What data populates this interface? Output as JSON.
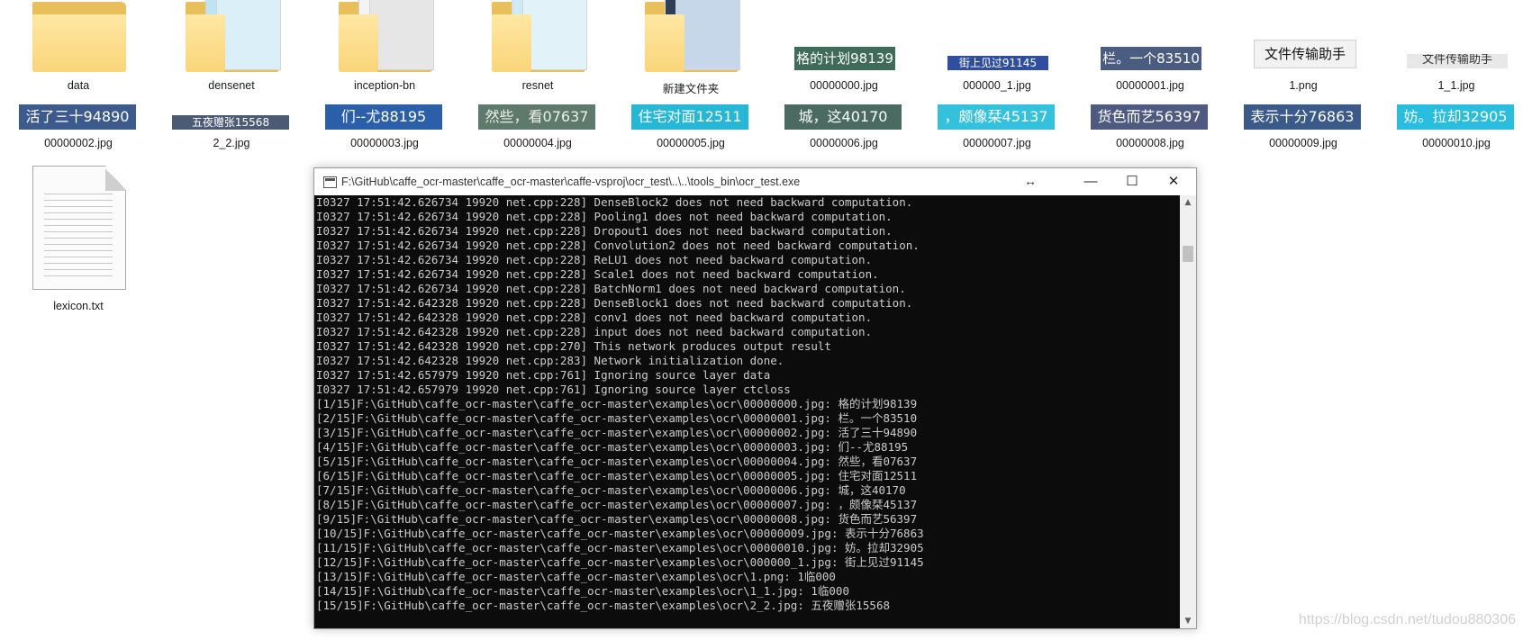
{
  "explorer": {
    "row1": [
      {
        "kind": "folder",
        "name": "data"
      },
      {
        "kind": "folder",
        "name": "densenet"
      },
      {
        "kind": "folder",
        "name": "inception-bn"
      },
      {
        "kind": "folder",
        "name": "resnet"
      },
      {
        "kind": "folder",
        "name": "新建文件夹"
      },
      {
        "kind": "image",
        "name": "00000000.jpg",
        "text": "格的计划98139",
        "bg": "#3f6b5a",
        "fg": "#ffffff"
      },
      {
        "kind": "image",
        "name": "000000_1.jpg",
        "text": "街上见过91145",
        "bg": "#2f4f9e",
        "fg": "#ffffff"
      },
      {
        "kind": "image",
        "name": "00000001.jpg",
        "text": "栏。一个83510",
        "bg": "#4a5d80",
        "fg": "#ffffff"
      },
      {
        "kind": "image",
        "name": "1.png",
        "text": "文件传输助手",
        "bg": "#f2f2f2",
        "fg": "#111111"
      },
      {
        "kind": "image",
        "name": "1_1.jpg",
        "text": "文件传输助手",
        "bg": "#e8e8e8",
        "fg": "#333333"
      }
    ],
    "row2": [
      {
        "name": "00000002.jpg",
        "text": "活了三十94890",
        "bg": "#3c5a8c",
        "fg": "#ffffff"
      },
      {
        "name": "2_2.jpg",
        "text": "五夜赠张15568",
        "bg": "#4c5a74",
        "fg": "#ffffff"
      },
      {
        "name": "00000003.jpg",
        "text": "们--尤88195",
        "bg": "#2c5faa",
        "fg": "#ffffff"
      },
      {
        "name": "00000004.jpg",
        "text": "然些，看07637",
        "bg": "#5e7a6c",
        "fg": "#eeeeee"
      },
      {
        "name": "00000005.jpg",
        "text": "住宅对面12511",
        "bg": "#27b7d6",
        "fg": "#ffffff"
      },
      {
        "name": "00000006.jpg",
        "text": "城，这40170",
        "bg": "#4b6b62",
        "fg": "#ffffff"
      },
      {
        "name": "00000007.jpg",
        "text": "，颇像栞45137",
        "bg": "#33c1de",
        "fg": "#ffffff"
      },
      {
        "name": "00000008.jpg",
        "text": "货色而艺56397",
        "bg": "#4e5a80",
        "fg": "#ffffff"
      },
      {
        "name": "00000009.jpg",
        "text": "表示十分76863",
        "bg": "#3b5a8a",
        "fg": "#ffffff"
      },
      {
        "name": "00000010.jpg",
        "text": "妨。拉却32905",
        "bg": "#29bde0",
        "fg": "#ffffff"
      }
    ],
    "row3": [
      {
        "kind": "text-file",
        "name": "lexicon.txt"
      }
    ]
  },
  "console_window": {
    "title": "F:\\GitHub\\caffe_ocr-master\\caffe_ocr-master\\caffe-vsproj\\ocr_test\\..\\..\\tools_bin\\ocr_test.exe",
    "controls": {
      "minimize": "—",
      "maximize": "☐",
      "close": "✕"
    },
    "lines": [
      "I0327 17:51:42.626734 19920 net.cpp:228] DenseBlock2 does not need backward computation.",
      "I0327 17:51:42.626734 19920 net.cpp:228] Pooling1 does not need backward computation.",
      "I0327 17:51:42.626734 19920 net.cpp:228] Dropout1 does not need backward computation.",
      "I0327 17:51:42.626734 19920 net.cpp:228] Convolution2 does not need backward computation.",
      "I0327 17:51:42.626734 19920 net.cpp:228] ReLU1 does not need backward computation.",
      "I0327 17:51:42.626734 19920 net.cpp:228] Scale1 does not need backward computation.",
      "I0327 17:51:42.626734 19920 net.cpp:228] BatchNorm1 does not need backward computation.",
      "I0327 17:51:42.642328 19920 net.cpp:228] DenseBlock1 does not need backward computation.",
      "I0327 17:51:42.642328 19920 net.cpp:228] conv1 does not need backward computation.",
      "I0327 17:51:42.642328 19920 net.cpp:228] input does not need backward computation.",
      "I0327 17:51:42.642328 19920 net.cpp:270] This network produces output result",
      "I0327 17:51:42.642328 19920 net.cpp:283] Network initialization done.",
      "I0327 17:51:42.657979 19920 net.cpp:761] Ignoring source layer data",
      "I0327 17:51:42.657979 19920 net.cpp:761] Ignoring source layer ctcloss",
      "[1/15]F:\\GitHub\\caffe_ocr-master\\caffe_ocr-master\\examples\\ocr\\00000000.jpg: 格的计划98139",
      "[2/15]F:\\GitHub\\caffe_ocr-master\\caffe_ocr-master\\examples\\ocr\\00000001.jpg: 栏。一个83510",
      "[3/15]F:\\GitHub\\caffe_ocr-master\\caffe_ocr-master\\examples\\ocr\\00000002.jpg: 活了三十94890",
      "[4/15]F:\\GitHub\\caffe_ocr-master\\caffe_ocr-master\\examples\\ocr\\00000003.jpg: 们--尤88195",
      "[5/15]F:\\GitHub\\caffe_ocr-master\\caffe_ocr-master\\examples\\ocr\\00000004.jpg: 然些，看07637",
      "[6/15]F:\\GitHub\\caffe_ocr-master\\caffe_ocr-master\\examples\\ocr\\00000005.jpg: 住宅对面12511",
      "[7/15]F:\\GitHub\\caffe_ocr-master\\caffe_ocr-master\\examples\\ocr\\00000006.jpg: 城，这40170",
      "[8/15]F:\\GitHub\\caffe_ocr-master\\caffe_ocr-master\\examples\\ocr\\00000007.jpg: ，颇像栞45137",
      "[9/15]F:\\GitHub\\caffe_ocr-master\\caffe_ocr-master\\examples\\ocr\\00000008.jpg: 货色而艺56397",
      "[10/15]F:\\GitHub\\caffe_ocr-master\\caffe_ocr-master\\examples\\ocr\\00000009.jpg: 表示十分76863",
      "[11/15]F:\\GitHub\\caffe_ocr-master\\caffe_ocr-master\\examples\\ocr\\00000010.jpg: 妨。拉却32905",
      "[12/15]F:\\GitHub\\caffe_ocr-master\\caffe_ocr-master\\examples\\ocr\\000000_1.jpg: 街上见过91145",
      "[13/15]F:\\GitHub\\caffe_ocr-master\\caffe_ocr-master\\examples\\ocr\\1.png: 1临000",
      "[14/15]F:\\GitHub\\caffe_ocr-master\\caffe_ocr-master\\examples\\ocr\\1_1.jpg: 1临000",
      "[15/15]F:\\GitHub\\caffe_ocr-master\\caffe_ocr-master\\examples\\ocr\\2_2.jpg: 五夜赠张15568"
    ]
  },
  "watermark": "https://blog.csdn.net/tudou880306",
  "colors": {
    "folder_front": "#f9d57a",
    "folder_back": "#e9bf5b",
    "console_bg": "#0c0c0c",
    "console_text": "#cccccc"
  }
}
